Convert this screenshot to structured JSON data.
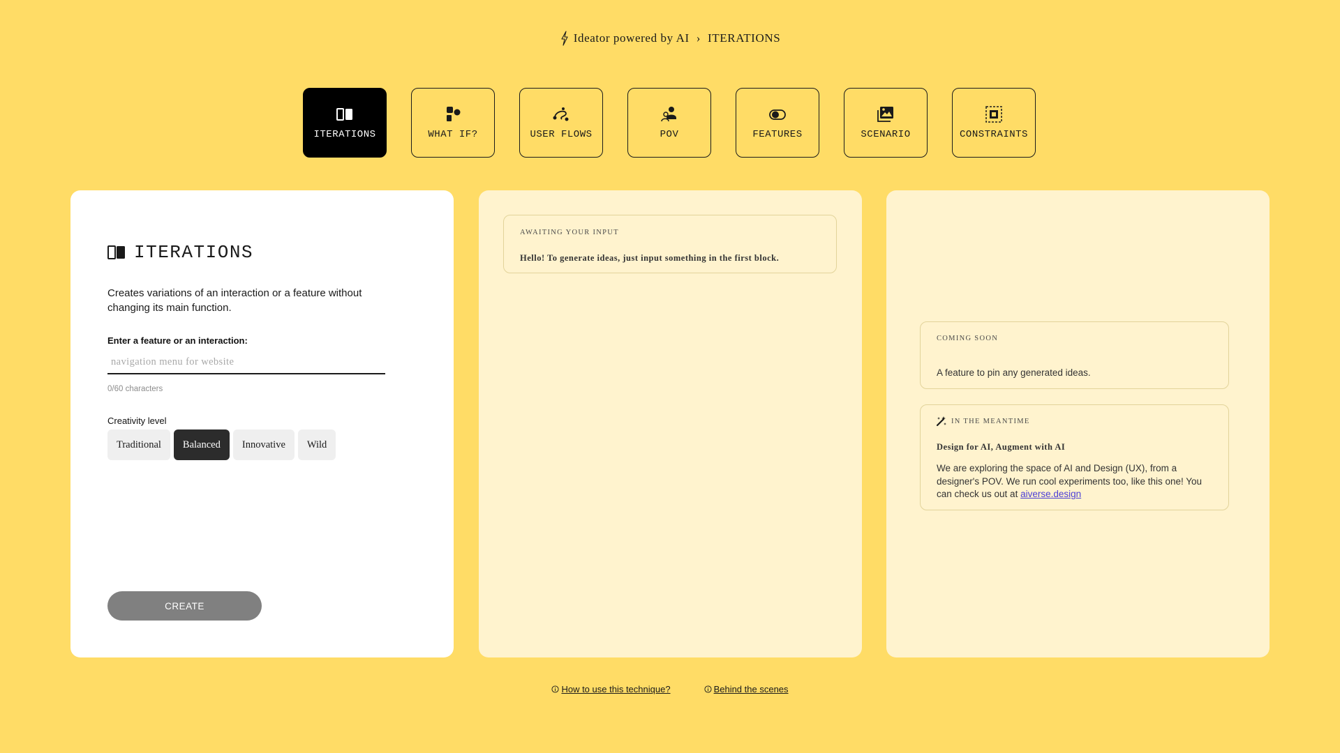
{
  "header": {
    "icon": "lightning-icon",
    "app_title": "Ideator powered by AI",
    "separator": "›",
    "current": "ITERATIONS"
  },
  "tabs": [
    {
      "label": "ITERATIONS",
      "icon": "iterations-icon",
      "active": true
    },
    {
      "label": "WHAT IF?",
      "icon": "shapes-icon",
      "active": false
    },
    {
      "label": "USER FLOWS",
      "icon": "flow-icon",
      "active": false
    },
    {
      "label": "POV",
      "icon": "people-icon",
      "active": false
    },
    {
      "label": "FEATURES",
      "icon": "toggle-icon",
      "active": false
    },
    {
      "label": "SCENARIO",
      "icon": "image-icon",
      "active": false
    },
    {
      "label": "CONSTRAINTS",
      "icon": "frame-icon",
      "active": false
    }
  ],
  "input_panel": {
    "title": "ITERATIONS",
    "title_icon": "iterations-icon",
    "description": "Creates variations of an interaction or a feature without changing its main function.",
    "field_label": "Enter a feature or an interaction:",
    "field_value": "",
    "field_placeholder": "navigation menu for website",
    "char_count": "0/60 characters",
    "creativity_label": "Creativity level",
    "levels": [
      "Traditional",
      "Balanced",
      "Innovative",
      "Wild"
    ],
    "selected_level": "Balanced",
    "create_label": "CREATE"
  },
  "output_panel": {
    "kicker": "AWAITING YOUR INPUT",
    "message": "Hello! To generate ideas, just input something in the first block."
  },
  "info_panel": {
    "soon_kicker": "COMING SOON",
    "soon_text": "A feature to pin any generated ideas.",
    "meantime_icon": "magic-wand-icon",
    "meantime_kicker": "IN THE MEANTIME",
    "meantime_title": "Design for AI, Augment with AI",
    "meantime_body": "We are exploring the space of AI and Design (UX), from a designer's POV. We run cool experiments too, like this one! You can check us out at",
    "meantime_link": "aiverse.design"
  },
  "footer": {
    "link1": "How to use this technique?",
    "link2": "Behind the scenes",
    "link_icon": "info-circle-icon"
  },
  "colors": {
    "background": "#FFDC66",
    "panel_light": "#FFF3CE",
    "active_tab": "#000000",
    "create_button": "#808080",
    "link": "#4b3fd6"
  }
}
